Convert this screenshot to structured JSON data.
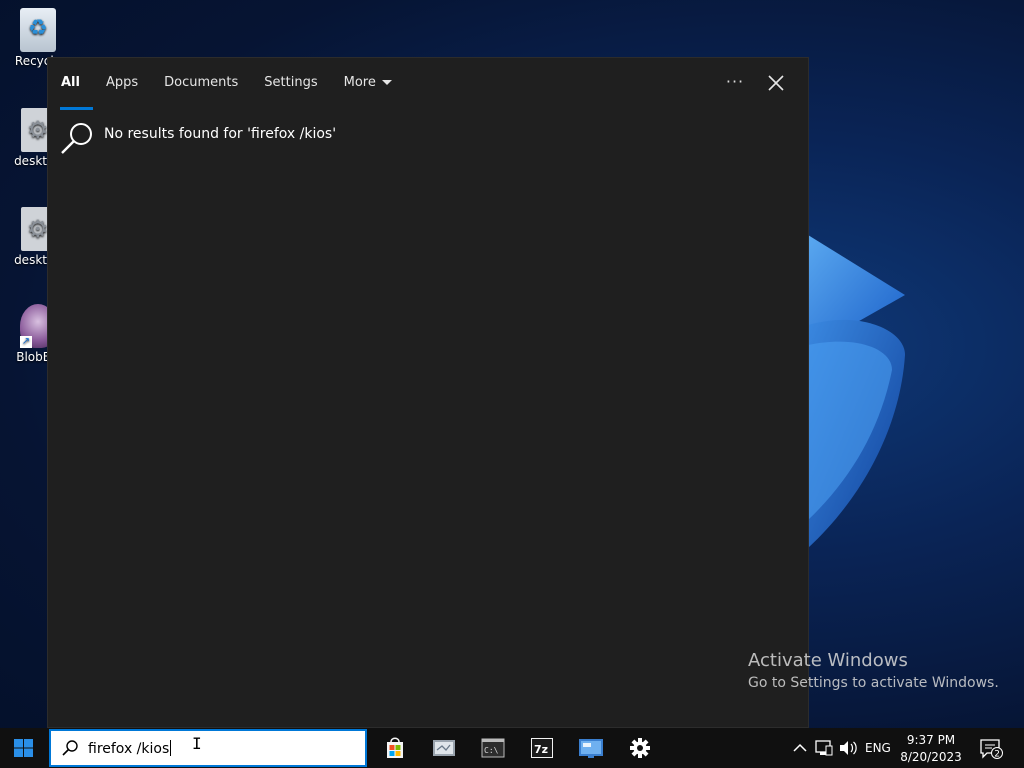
{
  "desktop": {
    "icons": [
      {
        "label": "Recycle",
        "icon": "recycle-bin-icon"
      },
      {
        "label": "desktop",
        "icon": "settings-file-icon"
      },
      {
        "label": "desktop",
        "icon": "settings-file-icon"
      },
      {
        "label": "BlobBU",
        "icon": "blob-app-icon"
      }
    ]
  },
  "search_panel": {
    "tabs": [
      {
        "label": "All",
        "active": true
      },
      {
        "label": "Apps",
        "active": false
      },
      {
        "label": "Documents",
        "active": false
      },
      {
        "label": "Settings",
        "active": false
      },
      {
        "label": "More",
        "active": false
      }
    ],
    "more_icon": "ellipsis-icon",
    "close_icon": "close-icon",
    "no_results_text": "No results found for 'firefox /kios'"
  },
  "watermark": {
    "line1": "Activate Windows",
    "line2": "Go to Settings to activate Windows."
  },
  "taskbar": {
    "search_value": "firefox /kios",
    "apps": [
      {
        "name": "store",
        "icon": "microsoft-store-icon"
      },
      {
        "name": "file-explorer",
        "icon": "file-explorer-icon"
      },
      {
        "name": "command-prompt",
        "icon": "command-prompt-icon",
        "label": "C:\\"
      },
      {
        "name": "7zip",
        "icon": "7zip-icon",
        "label": "7z"
      },
      {
        "name": "remote-desktop",
        "icon": "remote-desktop-icon"
      },
      {
        "name": "settings",
        "icon": "gear-icon"
      }
    ],
    "tray": {
      "language": "ENG",
      "time": "9:37 PM",
      "date": "8/20/2023",
      "notification_count": "2"
    }
  },
  "colors": {
    "accent": "#0078d7",
    "panel_bg": "#1f1f1f",
    "taskbar_bg": "#101010"
  }
}
